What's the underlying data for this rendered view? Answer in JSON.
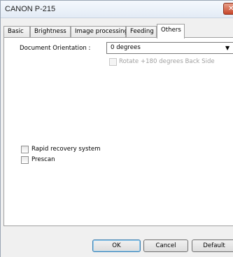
{
  "window": {
    "title": "CANON  P-215",
    "close_glyph": "✕"
  },
  "tabs": [
    {
      "label": "Basic"
    },
    {
      "label": "Brightness"
    },
    {
      "label": "Image processing"
    },
    {
      "label": "Feeding"
    },
    {
      "label": "Others",
      "active": true
    }
  ],
  "others": {
    "orientation_label": "Document Orientation :",
    "orientation_value": "0 degrees",
    "dropdown_arrow": "▼",
    "rotate_back_label": "Rotate +180 degrees Back Side",
    "rotate_back_checked": false,
    "rotate_back_enabled": false,
    "rapid_recovery_label": "Rapid recovery system",
    "rapid_recovery_checked": false,
    "prescan_label": "Prescan",
    "prescan_checked": false
  },
  "buttons": {
    "ok": "OK",
    "cancel": "Cancel",
    "default": "Default"
  }
}
